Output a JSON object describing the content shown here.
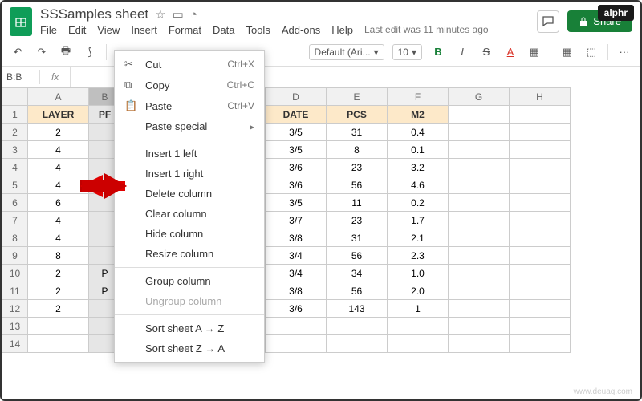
{
  "brand": "alphr",
  "watermark": "www.deuaq.com",
  "doc": {
    "title": "SSSamples sheet",
    "last_edit": "Last edit was 11 minutes ago"
  },
  "menu": {
    "file": "File",
    "edit": "Edit",
    "view": "View",
    "insert": "Insert",
    "format": "Format",
    "data": "Data",
    "tools": "Tools",
    "addons": "Add-ons",
    "help": "Help"
  },
  "share": {
    "label": "Share"
  },
  "toolbar": {
    "font": "Default (Ari...",
    "size": "10",
    "bold": "B",
    "italic": "I",
    "strike": "S",
    "more": "···"
  },
  "namebox": "B:B",
  "fx": "fx",
  "cols": [
    "A",
    "B",
    "",
    "D",
    "E",
    "F",
    "G",
    "H"
  ],
  "headers": {
    "a": "LAYER",
    "b": "PF",
    "d": "DATE",
    "e": "PCS",
    "f": "M2"
  },
  "rows": [
    {
      "n": "1"
    },
    {
      "n": "2",
      "a": "2",
      "d": "3/5",
      "e": "31",
      "f": "0.4"
    },
    {
      "n": "3",
      "a": "4",
      "d": "3/5",
      "e": "8",
      "f": "0.1"
    },
    {
      "n": "4",
      "a": "4",
      "d": "3/6",
      "e": "23",
      "f": "3.2"
    },
    {
      "n": "5",
      "a": "4",
      "d": "3/6",
      "e": "56",
      "f": "4.6"
    },
    {
      "n": "6",
      "a": "6",
      "d": "3/5",
      "e": "11",
      "f": "0.2"
    },
    {
      "n": "7",
      "a": "4",
      "d": "3/7",
      "e": "23",
      "f": "1.7"
    },
    {
      "n": "8",
      "a": "4",
      "d": "3/8",
      "e": "31",
      "f": "2.1"
    },
    {
      "n": "9",
      "a": "8",
      "d": "3/4",
      "e": "56",
      "f": "2.3"
    },
    {
      "n": "10",
      "a": "2",
      "b": "P",
      "d": "3/4",
      "e": "34",
      "f": "1.0"
    },
    {
      "n": "11",
      "a": "2",
      "b": "P",
      "d": "3/8",
      "e": "56",
      "f": "2.0"
    },
    {
      "n": "12",
      "a": "2",
      "d": "3/6",
      "e": "143",
      "f": "1"
    },
    {
      "n": "13"
    },
    {
      "n": "14"
    }
  ],
  "ctx": {
    "cut": "Cut",
    "cut_sc": "Ctrl+X",
    "copy": "Copy",
    "copy_sc": "Ctrl+C",
    "paste": "Paste",
    "paste_sc": "Ctrl+V",
    "paste_special": "Paste special",
    "ins_left": "Insert 1 left",
    "ins_right": "Insert 1 right",
    "del_col": "Delete column",
    "clear_col": "Clear column",
    "hide_col": "Hide column",
    "resize_col": "Resize column",
    "group_col": "Group column",
    "ungroup_col": "Ungroup column",
    "sort_az": "Sort sheet A → Z",
    "sort_za": "Sort sheet Z → A"
  }
}
